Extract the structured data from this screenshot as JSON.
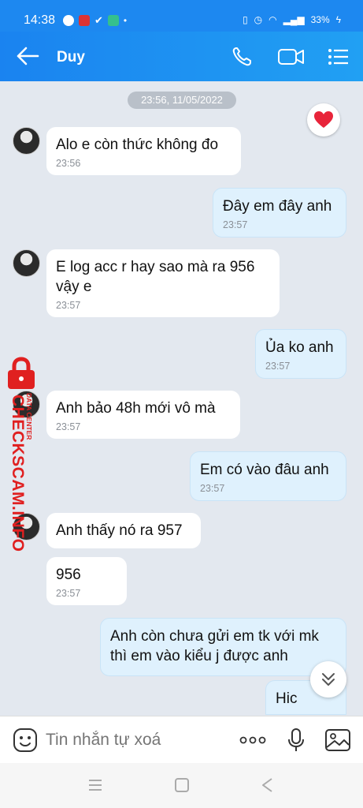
{
  "status_bar": {
    "time": "14:38",
    "battery": "33%"
  },
  "header": {
    "contact_name": "Duy"
  },
  "chat": {
    "date_separator": "23:56, 11/05/2022",
    "messages": [
      {
        "side": "in",
        "text": "Alo e còn thức không đo",
        "time": "23:56"
      },
      {
        "side": "out",
        "text": "Đây em đây anh",
        "time": "23:57"
      },
      {
        "side": "in",
        "text": "E log acc r hay sao mà ra 956 vậy e",
        "time": "23:57"
      },
      {
        "side": "out",
        "text": "Ủa ko anh",
        "time": "23:57"
      },
      {
        "side": "in",
        "text": "Anh bảo 48h mới vô mà",
        "time": "23:57"
      },
      {
        "side": "out",
        "text": "Em có vào đâu anh",
        "time": "23:57"
      },
      {
        "side": "in",
        "text": "Anh thấy nó ra 957",
        "time": ""
      },
      {
        "side": "in",
        "text": "956",
        "time": "23:57"
      },
      {
        "side": "out",
        "text": "Anh còn chưa gửi em tk với mk thì em vào kiểu j được anh",
        "time": ""
      },
      {
        "side": "out",
        "text": "Hic",
        "time": ""
      }
    ]
  },
  "watermark": {
    "text": "CHECKSCAM.INFO",
    "subtext": "DATA CENTER"
  },
  "composer": {
    "placeholder": "Tin nhắn tự xoá"
  },
  "icons": {
    "back": "arrow-left-icon",
    "call": "phone-icon",
    "video": "video-camera-icon",
    "menu": "list-menu-icon",
    "reaction": "heart-icon",
    "scroll": "chevron-double-down-icon",
    "emoji": "emoji-icon",
    "more": "more-dots-icon",
    "mic": "microphone-icon",
    "image": "image-icon"
  },
  "colors": {
    "header": "#1d88f0",
    "outgoing_bubble": "#dff1fd",
    "incoming_bubble": "#ffffff",
    "watermark": "#e02020"
  }
}
